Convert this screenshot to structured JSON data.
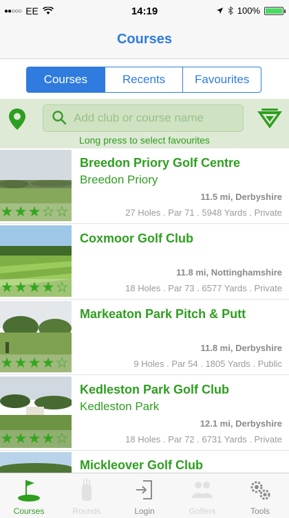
{
  "status_bar": {
    "carrier": "EE",
    "signal": "●●○○○",
    "time": "14:19",
    "battery_text": "100%",
    "battery_level": 1.0
  },
  "nav": {
    "title": "Courses"
  },
  "segments": [
    {
      "label": "Courses",
      "active": true
    },
    {
      "label": "Recents",
      "active": false
    },
    {
      "label": "Favourites",
      "active": false
    }
  ],
  "search": {
    "placeholder": "Add club or course name",
    "hint": "Long press to select favourites"
  },
  "courses": [
    {
      "name": "Breedon Priory Golf Centre",
      "sub": "Breedon Priory",
      "distance": "11.5 mi, Derbyshire",
      "info": "27 Holes . Par 71 . 5948 Yards . Private",
      "rating": 3
    },
    {
      "name": "Coxmoor Golf Club",
      "sub": "",
      "distance": "11.8 mi, Nottinghamshire",
      "info": "18 Holes . Par 73 . 6577 Yards . Private",
      "rating": 4
    },
    {
      "name": "Markeaton Park Pitch & Putt",
      "sub": "",
      "distance": "11.8 mi, Derbyshire",
      "info": "9 Holes . Par 54 . 1805 Yards . Public",
      "rating": 4
    },
    {
      "name": "Kedleston Park Golf Club",
      "sub": "Kedleston Park",
      "distance": "12.1 mi, Derbyshire",
      "info": "18 Holes . Par 72 . 6731 Yards . Private",
      "rating": 4
    },
    {
      "name": "Mickleover Golf Club",
      "sub": "",
      "distance": "",
      "info": "",
      "rating": 0
    }
  ],
  "tabs": [
    {
      "label": "Courses",
      "icon": "flag-icon",
      "state": "active"
    },
    {
      "label": "Rounds",
      "icon": "golf-bag-icon",
      "state": "disabled"
    },
    {
      "label": "Login",
      "icon": "login-icon",
      "state": "normal"
    },
    {
      "label": "Golfers",
      "icon": "golfers-icon",
      "state": "disabled"
    },
    {
      "label": "Tools",
      "icon": "gears-icon",
      "state": "normal"
    }
  ],
  "colors": {
    "accent_blue": "#2f7bde",
    "brand_green": "#2e9e1f",
    "search_band": "#dfead6"
  }
}
